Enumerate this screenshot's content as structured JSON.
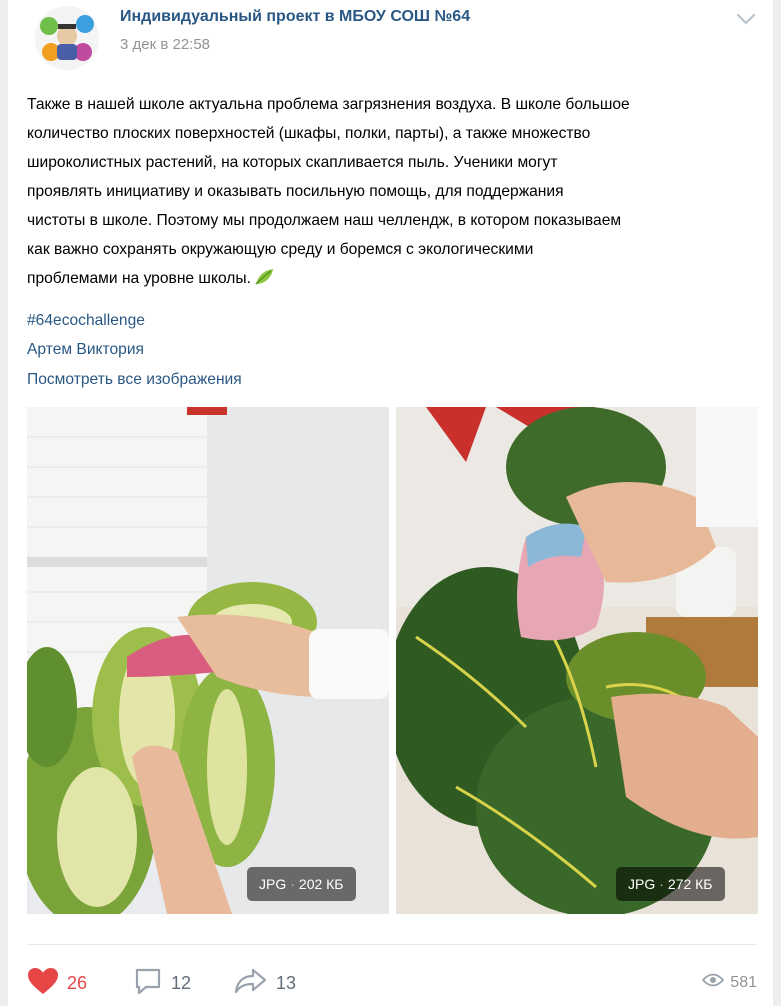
{
  "post": {
    "group_name": "Индивидуальный проект в МБОУ СОШ №64",
    "date": "3 дек в 22:58",
    "text": "Также в нашей школе актуальна проблема загрязнения воздуха. В школе большое\nколичество плоских поверхностей (шкафы, полки, парты), а также множество\nшироколистных растений, на которых скапливается пыль. Ученики могут\nпроявлять инициативу и оказывать посильную помощь, для поддержания\nчистоты в школе. Поэтому мы продолжаем наш челлендж, в котором показываем\nкак важно сохранять окружающую среду и боремся с экологическими\nпроблемами на уровне школы.",
    "hashtag": "#64ecochallenge",
    "authors": "Артем Виктория",
    "view_all_link": "Посмотреть все изображения"
  },
  "attachments": [
    {
      "format": "JPG",
      "size": "202 КБ"
    },
    {
      "format": "JPG",
      "size": "272 КБ"
    }
  ],
  "footer": {
    "likes": "26",
    "comments": "12",
    "shares": "13",
    "views": "581"
  },
  "icons": [
    "group-avatar-icon",
    "chevron-down-icon",
    "leaf-emoji-icon",
    "heart-icon",
    "comment-icon",
    "share-icon",
    "eye-icon"
  ],
  "colors": {
    "link": "#2a5885",
    "like": "#e64646",
    "muted": "#939393",
    "icon": "#99a2ad"
  }
}
